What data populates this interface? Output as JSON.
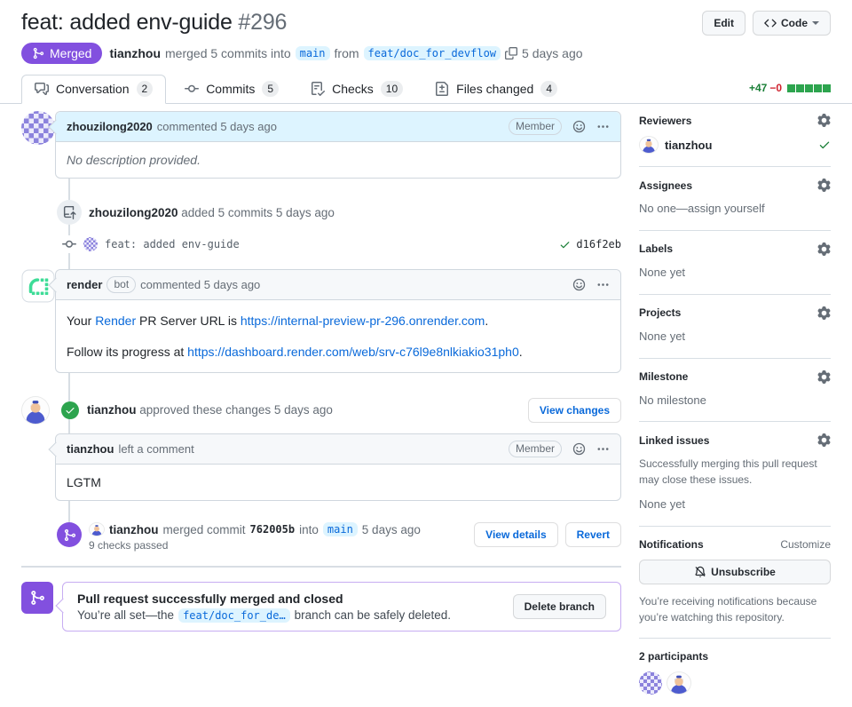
{
  "page": {
    "title": "feat: added env-guide",
    "number": "#296"
  },
  "header": {
    "edit_button": "Edit",
    "code_button": "Code",
    "status_badge": "Merged",
    "meta": {
      "author": "tianzhou",
      "action": "merged 5 commits into",
      "base_branch": "main",
      "from_word": "from",
      "head_branch": "feat/doc_for_devflow",
      "time": "5 days ago"
    }
  },
  "tabs": [
    {
      "label": "Conversation",
      "count": "2"
    },
    {
      "label": "Commits",
      "count": "5"
    },
    {
      "label": "Checks",
      "count": "10"
    },
    {
      "label": "Files changed",
      "count": "4"
    }
  ],
  "diffstat": {
    "additions": "+47",
    "deletions": "−0"
  },
  "timeline": {
    "comment1": {
      "author": "zhouzilong2020",
      "action": "commented 5 days ago",
      "badge": "Member",
      "body": "No description provided."
    },
    "commits_event": {
      "author": "zhouzilong2020",
      "action": "added 5 commits 5 days ago"
    },
    "commit_row": {
      "message": "feat: added env-guide",
      "sha": "d16f2eb"
    },
    "bot_comment": {
      "author": "render",
      "badge": "bot",
      "action": "commented 5 days ago",
      "line1_prefix": "Your",
      "line1_link1": "Render",
      "line1_mid": "PR Server URL is",
      "line1_link2": "https://internal-preview-pr-296.onrender.com",
      "line1_suffix": ".",
      "line2_prefix": "Follow its progress at",
      "line2_link": "https://dashboard.render.com/web/srv-c76l9e8nlkiakio31ph0",
      "line2_suffix": "."
    },
    "review_event": {
      "author": "tianzhou",
      "action": "approved these changes 5 days ago",
      "button": "View changes"
    },
    "comment2": {
      "author": "tianzhou",
      "action": "left a comment",
      "badge": "Member",
      "body": "LGTM"
    },
    "merge_event": {
      "author": "tianzhou",
      "action": "merged commit",
      "sha": "762005b",
      "into_word": "into",
      "branch": "main",
      "time": "5 days ago",
      "checks": "9 checks passed",
      "details_button": "View details",
      "revert_button": "Revert"
    },
    "merged_box": {
      "title": "Pull request successfully merged and closed",
      "body_prefix": "You’re all set—the",
      "branch": "feat/doc_for_de…",
      "body_suffix": "branch can be safely deleted.",
      "delete_button": "Delete branch"
    }
  },
  "sidebar": {
    "reviewers": {
      "heading": "Reviewers",
      "name": "tianzhou"
    },
    "assignees": {
      "heading": "Assignees",
      "empty_prefix": "No one—",
      "assign_link": "assign yourself"
    },
    "labels": {
      "heading": "Labels",
      "empty": "None yet"
    },
    "projects": {
      "heading": "Projects",
      "empty": "None yet"
    },
    "milestone": {
      "heading": "Milestone",
      "empty": "No milestone"
    },
    "linked_issues": {
      "heading": "Linked issues",
      "desc": "Successfully merging this pull request may close these issues.",
      "empty": "None yet"
    },
    "notifications": {
      "heading": "Notifications",
      "customize": "Customize",
      "button": "Unsubscribe",
      "caption": "You’re receiving notifications because you’re watching this repository."
    },
    "participants": {
      "heading": "2 participants"
    }
  },
  "icons": {
    "kebab-icon": "⋯",
    "caret-down-icon": "▾",
    "check-icon": "✓",
    "git-merge-icon": "svg git-merge glyph",
    "git-commit-icon": "svg -o- glyph",
    "gear-icon": "svg gear glyph",
    "smiley-icon": "svg smiley glyph",
    "bell-slash-icon": "svg muted bell glyph",
    "copy-icon": "svg copy glyph"
  },
  "colors": {
    "merged_purple": "#8250df",
    "link_blue": "#0969da",
    "added_green": "#1a7f37",
    "removed_red": "#cf222e",
    "label_bg_blue": "#ddf4ff"
  }
}
